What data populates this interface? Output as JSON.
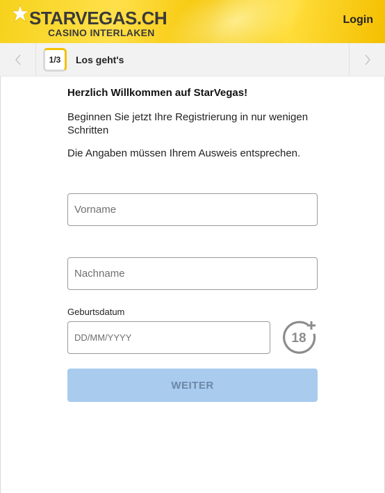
{
  "header": {
    "logo_main": "STARVEGAS.CH",
    "logo_sub": "CASINO INTERLAKEN",
    "login_label": "Login",
    "brand_color": "#f6d21c"
  },
  "stepbar": {
    "step_indicator": "1/3",
    "step_title": "Los geht's",
    "prev_icon": "chevron-left-icon",
    "next_icon": "chevron-right-icon"
  },
  "intro": {
    "welcome": "Herzlich Willkommen auf StarVegas!",
    "line1": "Beginnen Sie jetzt Ihre Registrierung in nur wenigen Schritten",
    "line2": "Die Angaben müssen Ihrem Ausweis entsprechen."
  },
  "form": {
    "firstname_placeholder": "Vorname",
    "firstname_value": "",
    "lastname_placeholder": "Nachname",
    "lastname_value": "",
    "dob_label": "Geburtsdatum",
    "dob_placeholder": "DD/MM/YYYY",
    "dob_value": "",
    "age_badge": "18+",
    "age_badge_icon": "age-18-plus-icon",
    "submit_label": "WEITER",
    "submit_color": "#a8cbee"
  }
}
